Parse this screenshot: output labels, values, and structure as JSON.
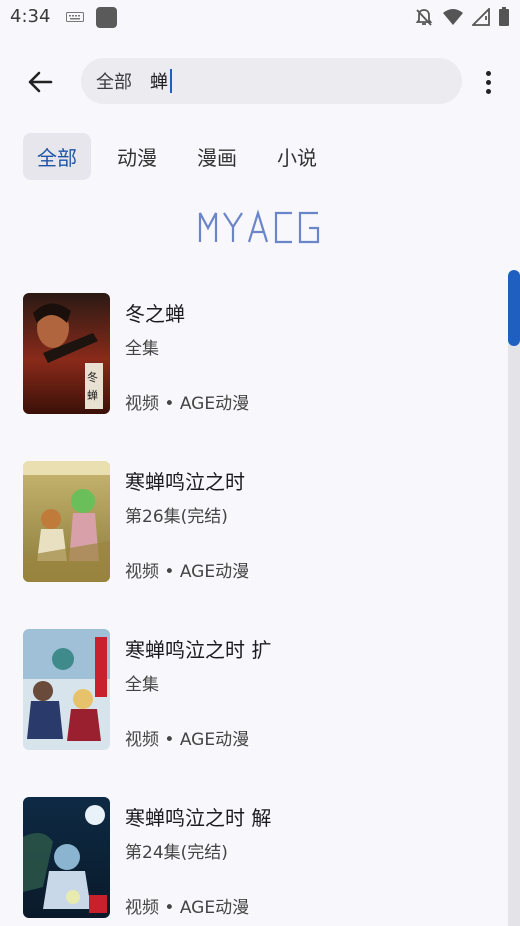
{
  "status_bar": {
    "time": "4:34",
    "icons": [
      "keyboard-icon",
      "app-notification-icon",
      "notifications-off-icon",
      "wifi-icon",
      "signal-icon",
      "battery-icon"
    ]
  },
  "search": {
    "category": "全部",
    "query": "蝉"
  },
  "tabs": [
    {
      "label": "全部",
      "active": true
    },
    {
      "label": "动漫",
      "active": false
    },
    {
      "label": "漫画",
      "active": false
    },
    {
      "label": "小说",
      "active": false
    }
  ],
  "logo_text": "MYACG",
  "results": [
    {
      "title": "冬之蝉",
      "episode": "全集",
      "meta": "视频 • AGE动漫"
    },
    {
      "title": "寒蝉鸣泣之时",
      "episode": "第26集(完结)",
      "meta": "视频 • AGE动漫"
    },
    {
      "title": "寒蝉鸣泣之时 扩",
      "episode": "全集",
      "meta": "视频 • AGE动漫"
    },
    {
      "title": "寒蝉鸣泣之时 解",
      "episode": "第24集(完结)",
      "meta": "视频 • AGE动漫"
    }
  ],
  "colors": {
    "accent": "#1f55a6",
    "background": "#f8f7fc",
    "scroll_thumb": "#1e5fc0"
  }
}
